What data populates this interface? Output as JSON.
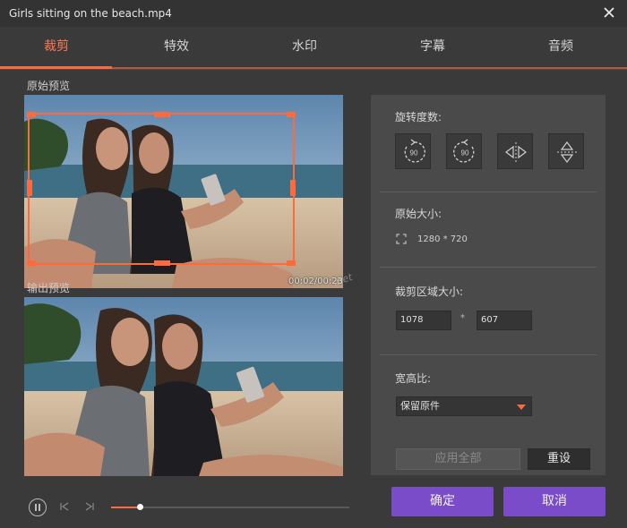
{
  "window": {
    "title": "Girls sitting on the beach.mp4"
  },
  "tabs": [
    {
      "label": "裁剪",
      "active": true
    },
    {
      "label": "特效",
      "active": false
    },
    {
      "label": "水印",
      "active": false
    },
    {
      "label": "字幕",
      "active": false
    },
    {
      "label": "音频",
      "active": false
    }
  ],
  "preview": {
    "original_label": "原始预览",
    "output_label": "输出预览",
    "timecode": "00:02/00:23"
  },
  "watermark_text": ".net",
  "panel": {
    "rotation_label": "旋转度数:",
    "rotate_left_text": "90",
    "rotate_right_text": "90",
    "original_size_label": "原始大小:",
    "original_size_value": "1280 * 720",
    "crop_area_label": "裁剪区域大小:",
    "crop_width": "1078",
    "crop_times": "*",
    "crop_height": "607",
    "aspect_label": "宽高比:",
    "aspect_value": "保留原件",
    "apply_all": "应用全部",
    "reset": "重设"
  },
  "footer": {
    "ok": "确定",
    "cancel": "取消"
  },
  "player": {
    "progress": 0.12
  },
  "colors": {
    "accent": "#ff6a3d",
    "button": "#7b4cc9",
    "panel": "#4a4a4a",
    "background": "#3a3a3a"
  },
  "icons": [
    "close-icon",
    "rotate-left-icon",
    "rotate-right-icon",
    "flip-horizontal-icon",
    "flip-vertical-icon",
    "resize-icon",
    "pause-icon",
    "previous-icon",
    "next-icon",
    "dropdown-caret-icon"
  ]
}
